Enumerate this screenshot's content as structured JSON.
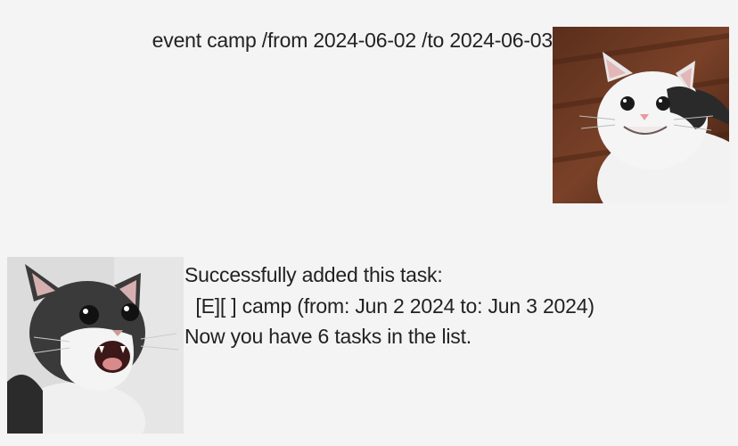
{
  "user": {
    "message": "event camp /from 2024-06-02 /to 2024-06-03",
    "avatar_icon": "smiling-cat-avatar"
  },
  "bot": {
    "lines": [
      "Successfully added this task:",
      "  [E][ ] camp (from: Jun 2 2024 to: Jun 3 2024)",
      "Now you have 6 tasks in the list."
    ],
    "avatar_icon": "screaming-cat-avatar"
  }
}
